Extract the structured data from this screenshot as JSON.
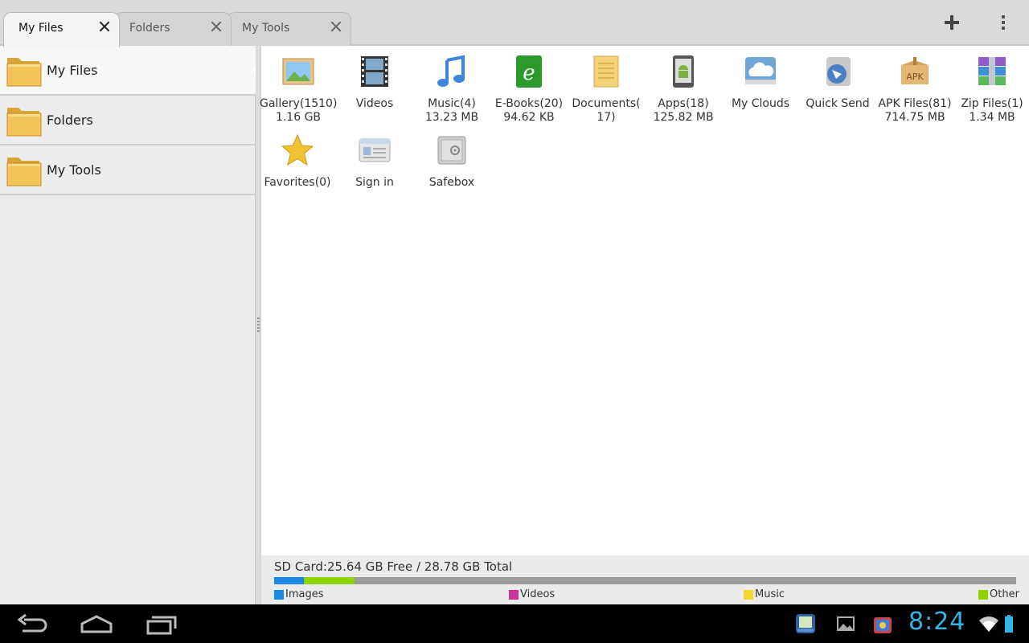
{
  "tabs": [
    {
      "label": "My Files",
      "active": true
    },
    {
      "label": "Folders",
      "active": false
    },
    {
      "label": "My Tools",
      "active": false
    }
  ],
  "toolbar": {
    "add_icon": "plus-icon",
    "menu_icon": "overflow-menu-icon"
  },
  "sidebar": {
    "items": [
      {
        "label": "My Files",
        "icon": "folder-icon",
        "active": true
      },
      {
        "label": "Folders",
        "icon": "folder-icon",
        "active": false
      },
      {
        "label": "My Tools",
        "icon": "folder-icon",
        "active": false
      }
    ]
  },
  "grid": {
    "items": [
      {
        "label": "Gallery(1510)",
        "sub": "1.16 GB",
        "icon": "gallery-icon"
      },
      {
        "label": "Videos",
        "sub": "",
        "icon": "film-icon"
      },
      {
        "label": "Music(4)",
        "sub": "13.23 MB",
        "icon": "music-note-icon"
      },
      {
        "label": "E-Books(20)",
        "sub": "94.62 KB",
        "icon": "ebook-icon"
      },
      {
        "label": "Documents(",
        "sub": "17)",
        "icon": "document-icon"
      },
      {
        "label": "Apps(18)",
        "sub": "125.82 MB",
        "icon": "android-app-icon"
      },
      {
        "label": "My Clouds",
        "sub": "",
        "icon": "cloud-icon"
      },
      {
        "label": "Quick Send",
        "sub": "",
        "icon": "quick-send-icon"
      },
      {
        "label": "APK Files(81)",
        "sub": "714.75 MB",
        "icon": "apk-box-icon"
      },
      {
        "label": "Zip Files(1)",
        "sub": "1.34 MB",
        "icon": "zip-archive-icon"
      },
      {
        "label": "Favorites(0)",
        "sub": "",
        "icon": "star-icon"
      },
      {
        "label": "Sign in",
        "sub": "",
        "icon": "id-card-icon"
      },
      {
        "label": "Safebox",
        "sub": "",
        "icon": "safe-icon"
      }
    ]
  },
  "storage": {
    "title": "SD Card:25.64 GB Free  / 28.78 GB Total",
    "usage": {
      "images": 0.04,
      "videos": 0.0,
      "music": 0.0,
      "other": 0.068
    },
    "legend": [
      {
        "label": "Images",
        "color": "#1e88e5"
      },
      {
        "label": "Videos",
        "color": "#cc3399"
      },
      {
        "label": "Music",
        "color": "#f2d82e"
      },
      {
        "label": "Other",
        "color": "#8fd400"
      }
    ]
  },
  "system": {
    "clock": "8:24",
    "nav": [
      "back-icon",
      "home-icon",
      "recent-apps-icon"
    ],
    "notifications": [
      "es-app-icon",
      "gallery-notification-icon",
      "store-notification-icon",
      "wifi-icon",
      "battery-icon"
    ]
  }
}
